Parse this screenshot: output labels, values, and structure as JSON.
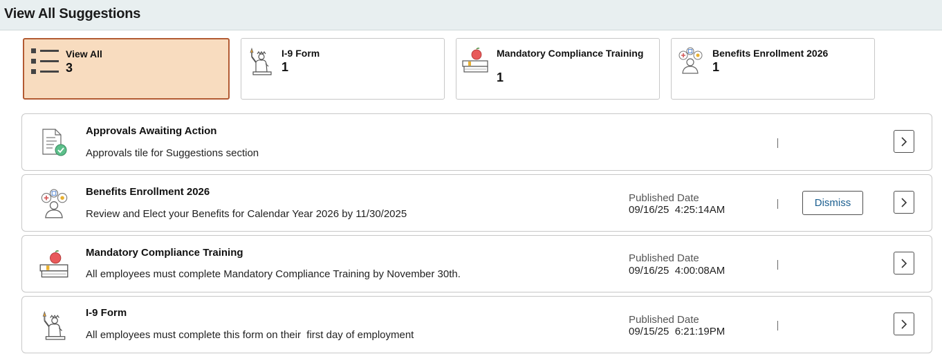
{
  "page": {
    "title": "View All Suggestions"
  },
  "tiles": [
    {
      "label": "View All",
      "count": "3",
      "icon": "list-icon",
      "active": true
    },
    {
      "label": "I-9 Form",
      "count": "1",
      "icon": "statue-of-liberty-icon"
    },
    {
      "label": "Mandatory Compliance Training",
      "count": "1",
      "icon": "apple-books-icon"
    },
    {
      "label": "Benefits Enrollment 2026",
      "count": "1",
      "icon": "benefits-person-icon"
    }
  ],
  "cards": [
    {
      "title": "Approvals Awaiting Action",
      "description": "Approvals tile for Suggestions section",
      "icon": "document-check-icon"
    },
    {
      "title": "Benefits Enrollment 2026",
      "description": "Review and Elect your Benefits for Calendar Year 2026 by 11/30/2025",
      "published_label": "Published Date",
      "published_date": "09/16/25  4:25:14AM",
      "dismiss_label": "Dismiss",
      "icon": "benefits-person-icon"
    },
    {
      "title": "Mandatory Compliance Training",
      "description": "All employees must complete Mandatory Compliance Training by November 30th.",
      "published_label": "Published Date",
      "published_date": "09/16/25  4:00:08AM",
      "icon": "apple-books-icon"
    },
    {
      "title": "I-9 Form",
      "description": "All employees must complete this form on their  first day of employment",
      "published_label": "Published Date",
      "published_date": "09/15/25  6:21:19PM",
      "icon": "statue-of-liberty-icon"
    }
  ],
  "colors": {
    "header_bg": "#e8eff0",
    "active_tile_bg": "#f8dcbf",
    "active_tile_border": "#b25a32",
    "link_blue": "#1a5e8f"
  }
}
